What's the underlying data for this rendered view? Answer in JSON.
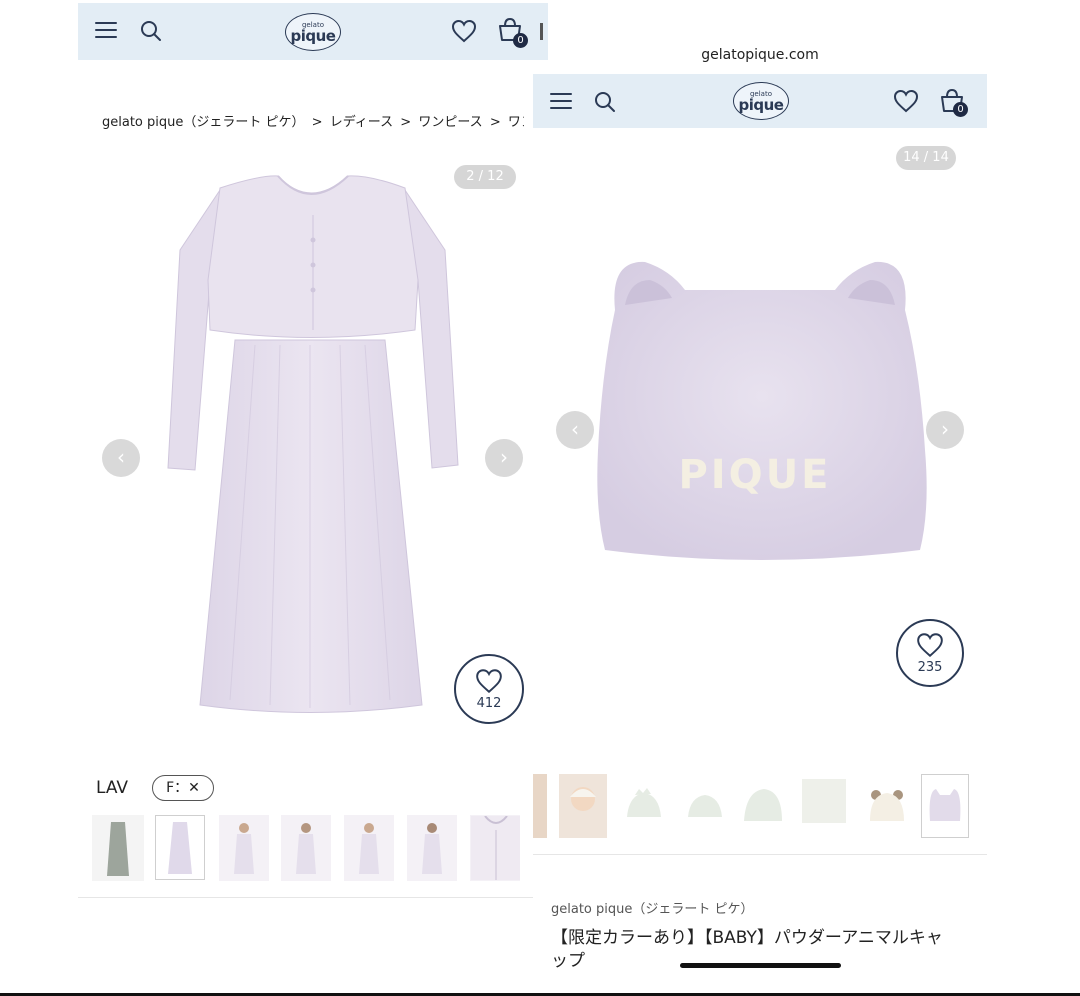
{
  "left": {
    "header": {
      "logo_small": "gelato",
      "logo_big": "pique",
      "cart_count": "0"
    },
    "breadcrumb": [
      "gelato pique（ジェラート ピケ）",
      "レディース",
      "ワンピース",
      "ワンピー"
    ],
    "image_counter": "2 / 12",
    "favorite_count": "412",
    "color_label": "LAV",
    "size_chip": "F：✕"
  },
  "right": {
    "url": "gelatopique.com",
    "header": {
      "logo_small": "gelato",
      "logo_big": "pique",
      "cart_count": "0"
    },
    "image_counter": "14 / 14",
    "favorite_count": "235",
    "hat_text": "PIQUE",
    "brand": "gelato pique（ジェラート ピケ）",
    "product_title_line1": "【限定カラーあり】【BABY】パウダーアニマルキャ",
    "product_title_line2": "ップ"
  },
  "colors": {
    "nav_bg": "#e3edf5",
    "navy": "#2b3a55",
    "lavender": "#e6e0ee"
  }
}
